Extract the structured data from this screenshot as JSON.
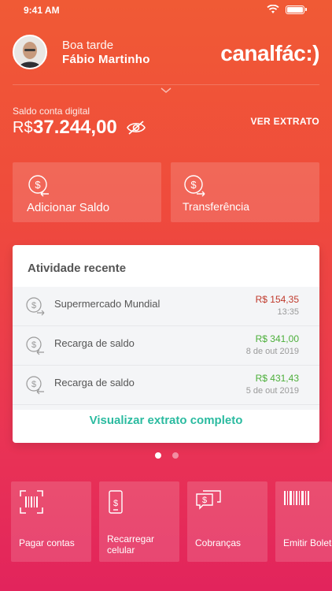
{
  "status_bar": {
    "time": "9:41 AM"
  },
  "header": {
    "greeting": "Boa tarde",
    "user_name": "Fábio Martinho",
    "logo": "canalfác:)"
  },
  "balance": {
    "label": "Saldo conta digital",
    "currency": "R$",
    "value": "37.244,00",
    "extract_link": "VER EXTRATO"
  },
  "actions": [
    {
      "label": "Adicionar Saldo",
      "icon": "add-money-icon"
    },
    {
      "label": "Transferência",
      "icon": "transfer-icon"
    }
  ],
  "activity": {
    "title": "Atividade recente",
    "items": [
      {
        "name": "Supermercado Mundial",
        "amount": "R$ 154,35",
        "date": "13:35",
        "type": "debit"
      },
      {
        "name": "Recarga de saldo",
        "amount": "R$ 341,00",
        "date": "8 de out 2019",
        "type": "credit"
      },
      {
        "name": "Recarga de saldo",
        "amount": "R$ 431,43",
        "date": "5 de out 2019",
        "type": "credit"
      }
    ],
    "view_all": "Visualizar extrato completo"
  },
  "pager": {
    "count": 2,
    "active": 0
  },
  "quick_actions": [
    {
      "label": "Pagar contas",
      "icon": "barcode-scan-icon"
    },
    {
      "label": "Recarregar celular",
      "icon": "phone-recharge-icon"
    },
    {
      "label": "Cobranças",
      "icon": "charge-icon"
    },
    {
      "label": "Emitir Boleto",
      "icon": "barcode-icon"
    }
  ],
  "colors": {
    "background_top": "#f05a35",
    "background_bottom": "#e2245c",
    "debit": "#c0392b",
    "credit": "#4caf3a",
    "link": "#2bbba0"
  }
}
